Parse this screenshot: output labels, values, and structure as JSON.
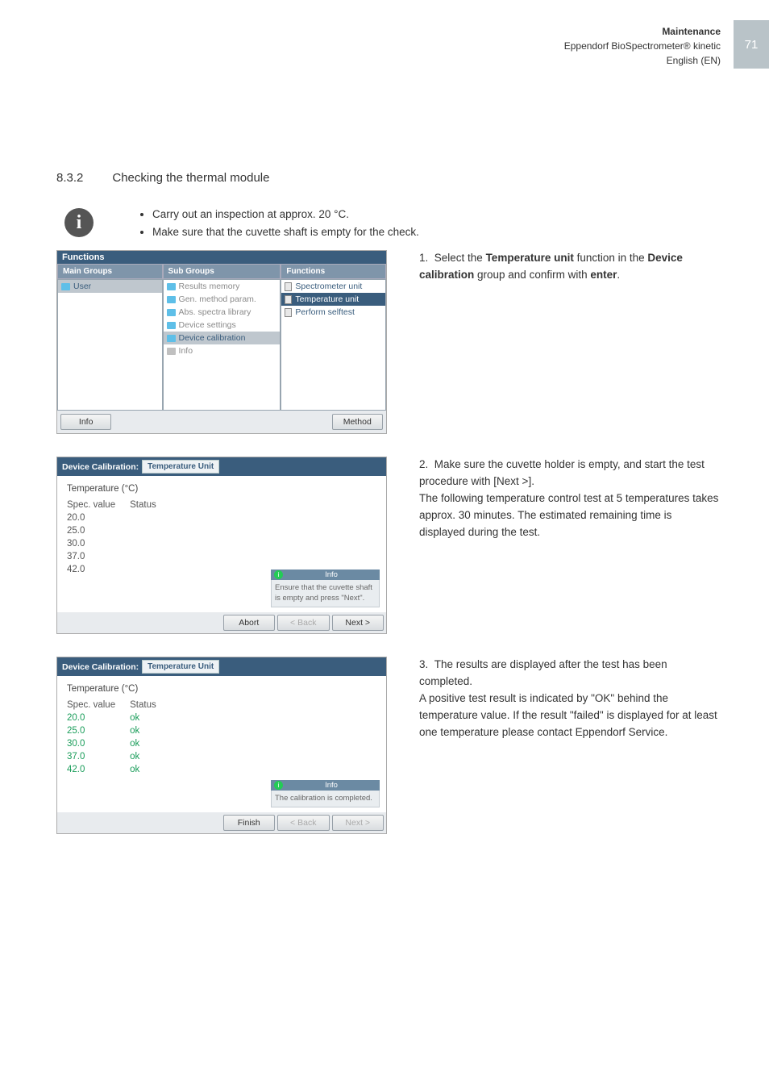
{
  "header": {
    "line1": "Maintenance",
    "line2": "Eppendorf BioSpectrometer® kinetic",
    "line3": "English (EN)",
    "page_num": "71"
  },
  "section": {
    "number": "8.3.2",
    "title": "Checking the thermal module"
  },
  "bullets": [
    "Carry out an inspection at approx. 20 °C.",
    "Make sure that the cuvette shaft is empty for the check."
  ],
  "steps": {
    "s1": "1.  Select the Temperature unit function in the Device calibration group and confirm with enter.",
    "s2": "2.  Make sure the cuvette holder is empty, and start the test procedure with [Next >]. The following temperature control test at 5 temperatures takes approx. 30 minutes. The estimated remaining time is displayed during the test.",
    "s3": "3.  The results are displayed after the test has been completed. A positive test result is indicated by \"OK\" behind the temperature value. If the result \"failed\" is displayed for at least one temperature please contact Eppendorf Service."
  },
  "sc1": {
    "title": "Functions",
    "head": {
      "a": "Main Groups",
      "b": "Sub Groups",
      "c": "Functions"
    },
    "colA": [
      "User"
    ],
    "colB": [
      "Results memory",
      "Gen. method param.",
      "Abs. spectra library",
      "Device settings",
      "Device calibration",
      "Info"
    ],
    "colC": [
      "Spectrometer unit",
      "Temperature unit",
      "Perform selftest"
    ],
    "btn_info": "Info",
    "btn_method": "Method"
  },
  "sc2": {
    "head_label": "Device Calibration:",
    "tab": "Temperature Unit",
    "temp_hdr": "Temperature (°C)",
    "col1": "Spec. value",
    "col2": "Status",
    "rows": [
      {
        "v": "20.0",
        "s": ""
      },
      {
        "v": "25.0",
        "s": ""
      },
      {
        "v": "30.0",
        "s": ""
      },
      {
        "v": "37.0",
        "s": ""
      },
      {
        "v": "42.0",
        "s": ""
      }
    ],
    "info_hd": "Info",
    "info_txt": "Ensure that the cuvette shaft is empty and press \"Next\".",
    "btn_abort": "Abort",
    "btn_back": "< Back",
    "btn_next": "Next >"
  },
  "sc3": {
    "head_label": "Device Calibration:",
    "tab": "Temperature Unit",
    "temp_hdr": "Temperature (°C)",
    "col1": "Spec. value",
    "col2": "Status",
    "rows": [
      {
        "v": "20.0",
        "s": "ok"
      },
      {
        "v": "25.0",
        "s": "ok"
      },
      {
        "v": "30.0",
        "s": "ok"
      },
      {
        "v": "37.0",
        "s": "ok"
      },
      {
        "v": "42.0",
        "s": "ok"
      }
    ],
    "info_hd": "Info",
    "info_txt": "The calibration is completed.",
    "btn_finish": "Finish",
    "btn_back": "< Back",
    "btn_next": "Next >"
  }
}
